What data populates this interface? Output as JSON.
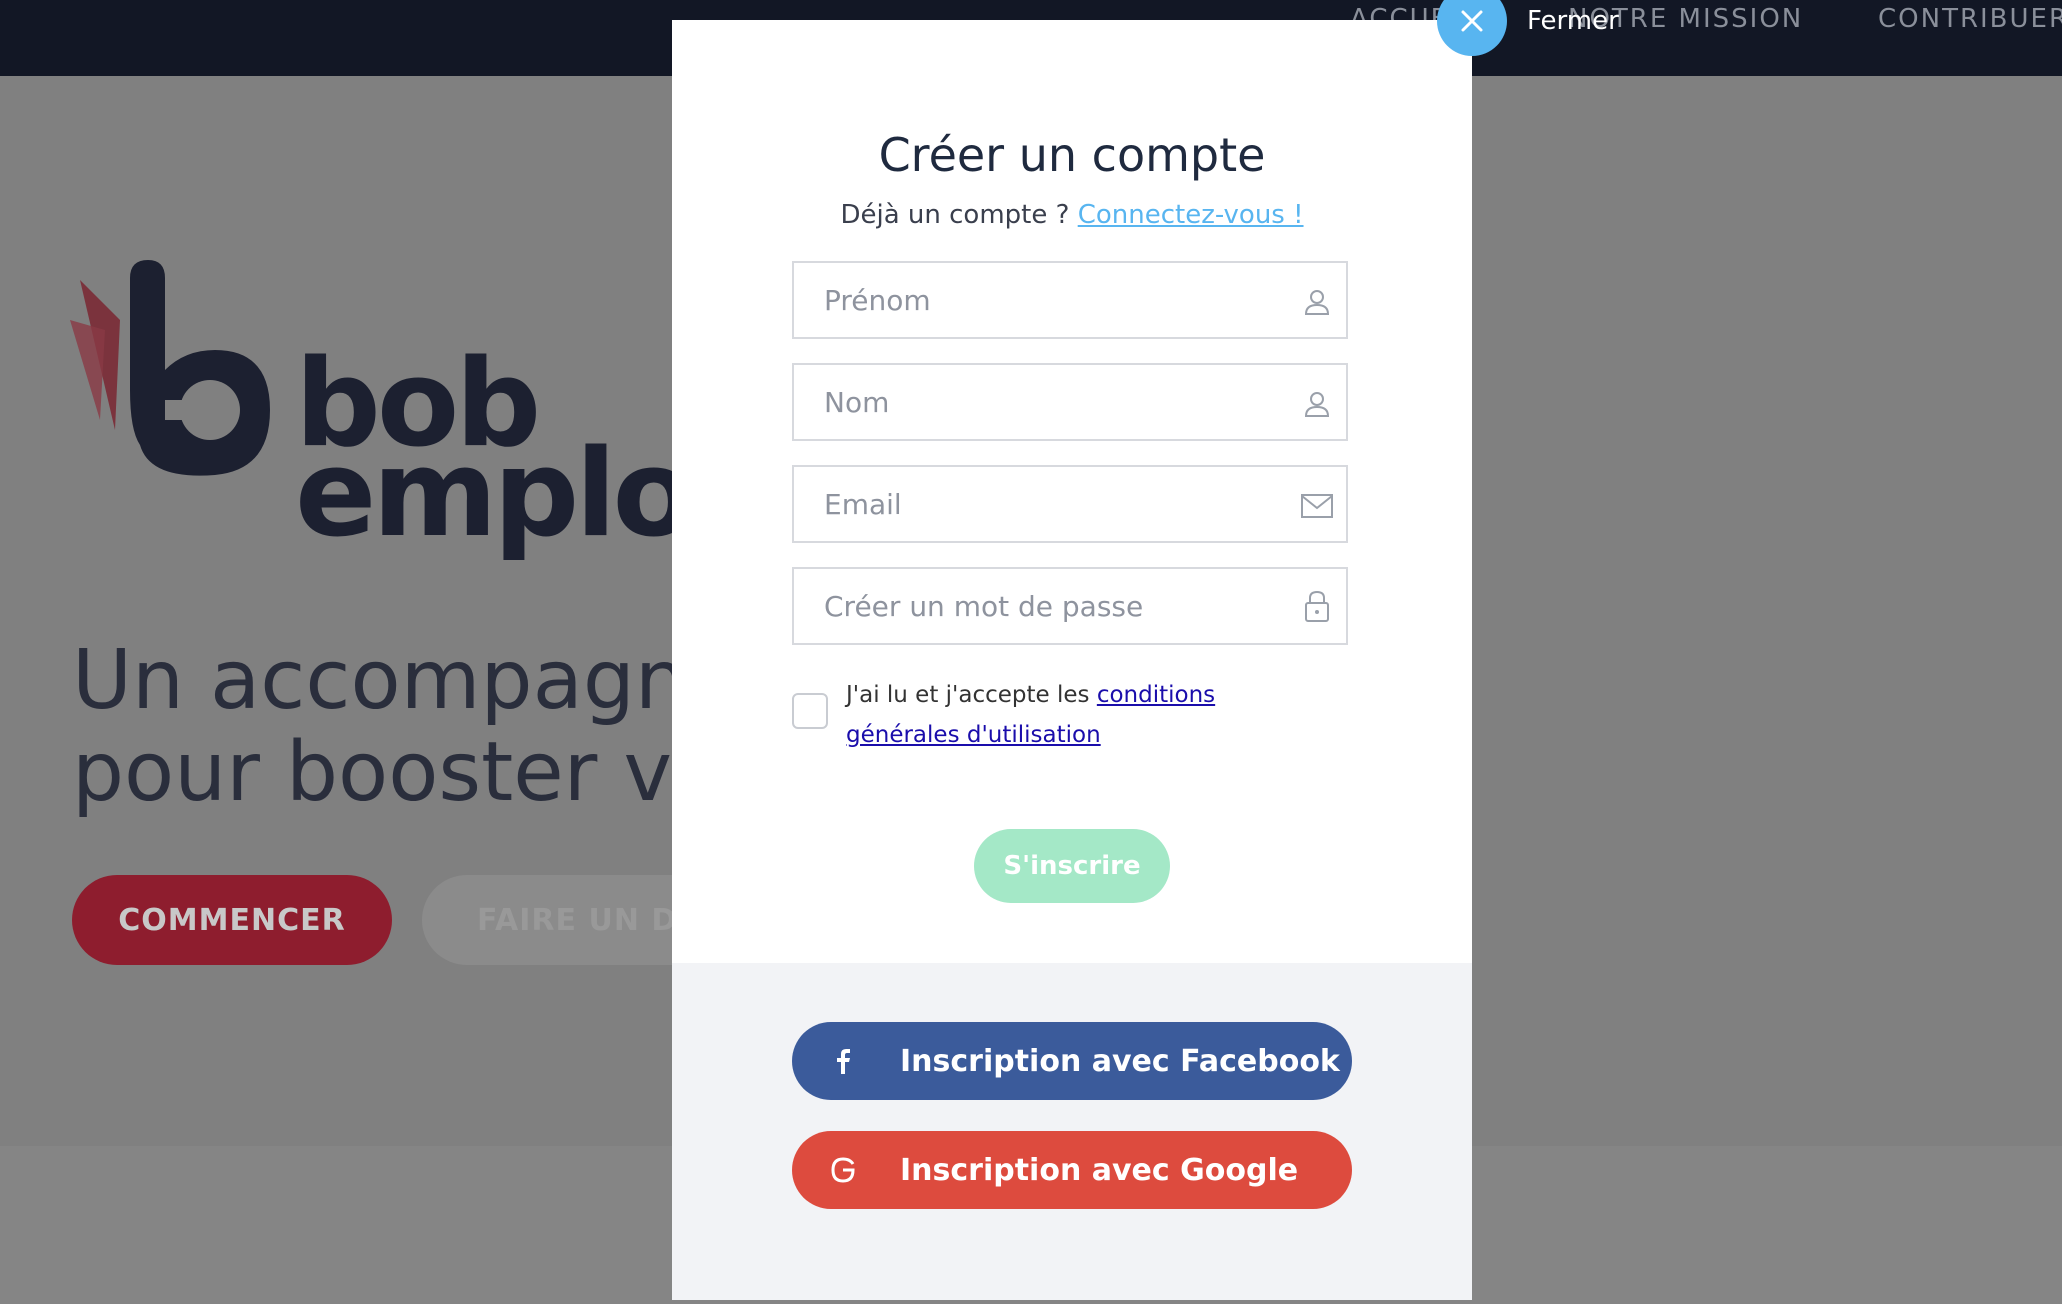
{
  "nav": {
    "items": [
      "ACCUEIL",
      "NOTRE MISSION",
      "CONTRIBUER"
    ]
  },
  "hero": {
    "logo_line1": "bob",
    "logo_line2": "emploi",
    "tagline_line1": "Un accompagnement",
    "tagline_line2": "pour booster votre",
    "start_button": "COMMENCER",
    "donate_button": "FAIRE UN DON"
  },
  "modal": {
    "close_label": "Fermer",
    "title": "Créer un compte",
    "subtitle_text": "Déjà un compte ?",
    "login_link": "Connectez-vous !",
    "fields": {
      "firstname_placeholder": "Prénom",
      "lastname_placeholder": "Nom",
      "email_placeholder": "Email",
      "password_placeholder": "Créer un mot de passe"
    },
    "terms_text": "J'ai lu et j'accepte les",
    "terms_link": "conditions générales d'utilisation",
    "terms_checked": false,
    "submit_label": "S'inscrire",
    "facebook_label": "Inscription avec Facebook",
    "google_label": "Inscription avec Google"
  },
  "icons": {
    "firstname": "user-icon",
    "lastname": "user-icon",
    "email": "envelope-icon",
    "password": "lock-icon",
    "close": "close-icon",
    "facebook": "facebook-icon",
    "google": "google-icon"
  },
  "colors": {
    "accent_blue": "#58b5f0",
    "submit_green": "#a4e8c7",
    "facebook_blue": "#3b5b9b",
    "google_red": "#dd4b3e",
    "brand_red": "#8e1d2e"
  }
}
